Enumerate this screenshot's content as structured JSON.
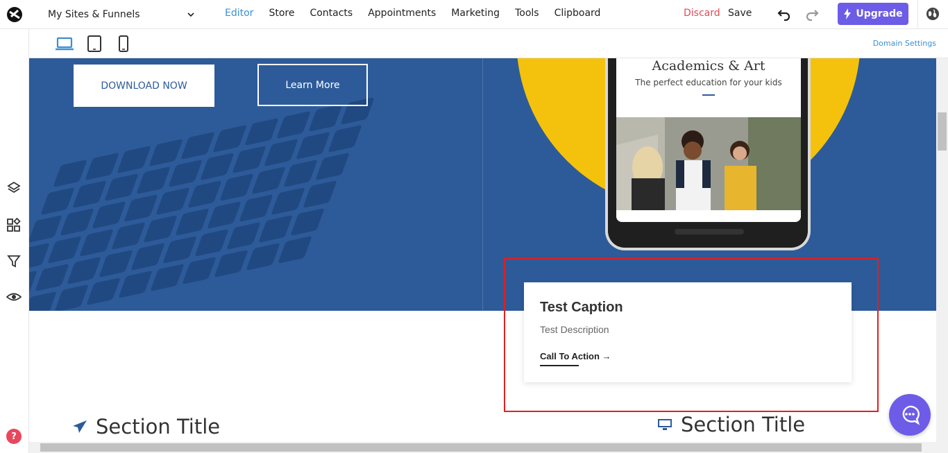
{
  "topbar": {
    "site_select": "My Sites & Funnels",
    "nav": [
      "Editor",
      "Store",
      "Contacts",
      "Appointments",
      "Marketing",
      "Tools",
      "Clipboard"
    ],
    "active_nav": "Editor",
    "discard": "Discard",
    "save": "Save",
    "upgrade": "Upgrade"
  },
  "devicebar": {
    "domain_settings": "Domain Settings"
  },
  "hero": {
    "download_button": "DOWNLOAD NOW",
    "learn_button": "Learn More"
  },
  "phone": {
    "title": "Academics & Art",
    "subtitle": "The perfect education for your kids"
  },
  "card": {
    "title": "Test Caption",
    "description": "Test Description",
    "cta": "Call To Action →"
  },
  "sections": {
    "left_title": "Section Title",
    "right_title": "Section Title"
  },
  "help": "?",
  "colors": {
    "accent": "#6c5ce7",
    "link": "#3b8fd4",
    "discard": "#e04b57",
    "hero": "#2d5b9a",
    "selection": "#e0201f",
    "yellow": "#f4c20d"
  }
}
